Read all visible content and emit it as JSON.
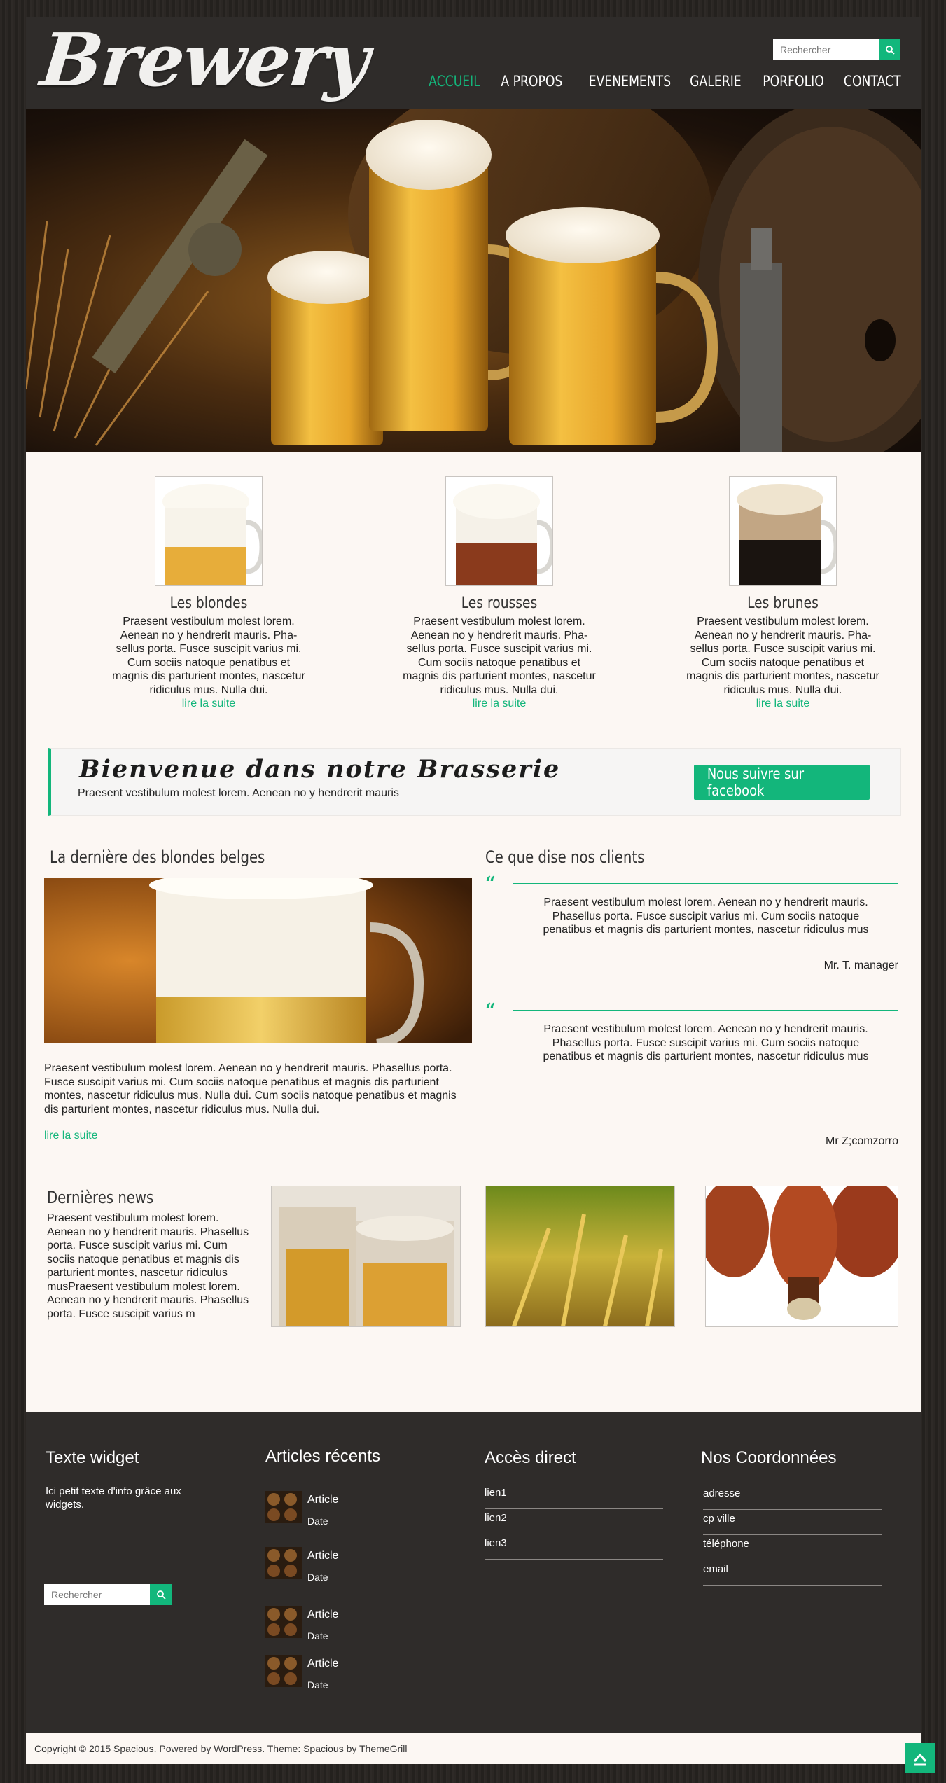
{
  "header": {
    "logo": "Brewery",
    "search_placeholder": "Rechercher",
    "nav": [
      "ACCUEIL",
      "A PROPOS",
      "EVENEMENTS",
      "GALERIE",
      "PORFOLIO",
      "CONTACT"
    ]
  },
  "features": [
    {
      "title": "Les blondes",
      "text": "Praesent vestibulum molest lorem. Aenean no y hendrerit mauris. Pha­sellus porta. Fusce suscipit varius mi. Cum sociis natoque penatibus et magnis dis parturient montes, nasce­tur ridiculus mus. Nulla dui.",
      "link": "lire la suite"
    },
    {
      "title": "Les rousses",
      "text": "Praesent vestibulum molest lorem. Aenean no y hendrerit mauris. Pha­sellus porta. Fusce suscipit varius mi. Cum sociis natoque penatibus et magnis dis parturient montes, nasce­tur ridiculus mus. Nulla dui.",
      "link": "lire la suite"
    },
    {
      "title": "Les brunes",
      "text": "Praesent vestibulum molest lorem. Aenean no y hendrerit mauris. Pha­sellus porta. Fusce suscipit varius mi. Cum sociis natoque penatibus et magnis dis parturient montes, nasce­tur ridiculus mus. Nulla dui.",
      "link": "lire la suite"
    }
  ],
  "callout": {
    "title": "Bienvenue dans notre Brasserie",
    "text": "Praesent vestibulum molest lorem. Aenean no y hendrerit mauris",
    "button": "Nous suivre sur facebook"
  },
  "blog": {
    "title": "La dernière des blondes belges",
    "text": "Praesent vestibulum molest lorem. Aenean no y hendrerit mauris. Phasellus porta. Fusce suscipit varius mi. Cum sociis natoque penatibus et magnis dis parturient montes, nascetur ridiculus mus. Nulla dui. Cum sociis natoque pe­natibus et magnis dis parturient montes, nascetur ridiculus mus. Nulla dui.",
    "link": "lire la suite"
  },
  "testimonials": {
    "title": "Ce que dise nos clients",
    "items": [
      {
        "text": "Praesent vestibulum molest lorem. Aenean no y hendrerit mauris. Phasellus porta. Fusce suscipit varius mi. Cum sociis natoque penatibus et magnis dis parturient montes, nascetur ridiculus mus",
        "author": "Mr. T. manager"
      },
      {
        "text": "Praesent vestibulum molest lorem. Aenean no y hendrerit mauris. Phasellus porta. Fusce suscipit varius mi. Cum sociis natoque penatibus et magnis dis parturient montes, nascetur ridiculus mus",
        "author": "Mr Z;comzorro"
      }
    ]
  },
  "news": {
    "title": "Dernières news",
    "text": "Praesent vestibulum molest lorem. Aenean no y hendrerit mauris. Pha­sellus porta. Fusce suscipit varius mi. Cum sociis natoque penatibus et magnis dis parturient montes, nasce­tur ridiculus musPraesent vestibulum molest lorem. Aenean no y hendrerit mauris. Phasellus porta. Fusce susci­pit varius m"
  },
  "footer": {
    "widget_title": "Texte widget",
    "widget_text": "Ici petit texte d'info grâce aux widgets.",
    "search_placeholder": "Rechercher",
    "recent_title": "Articles récents",
    "articles": [
      {
        "title": "Article",
        "date": "Date"
      },
      {
        "title": "Article",
        "date": "Date"
      },
      {
        "title": "Article",
        "date": "Date"
      },
      {
        "title": "Article",
        "date": "Date"
      }
    ],
    "links_title": "Accès direct",
    "links": [
      "lien1",
      "lien2",
      "lien3"
    ],
    "contact_title": "Nos Coordonnées",
    "contact": [
      "adresse",
      "cp ville",
      "téléphone",
      "email"
    ],
    "copyright": "Copyright © 2015 Spacious. Powered by WordPress. Theme: Spacious by ThemeGrill"
  },
  "colors": {
    "accent": "#13b67b",
    "header_bg": "#2f2c2a",
    "page_bg": "#fcf7f3"
  }
}
